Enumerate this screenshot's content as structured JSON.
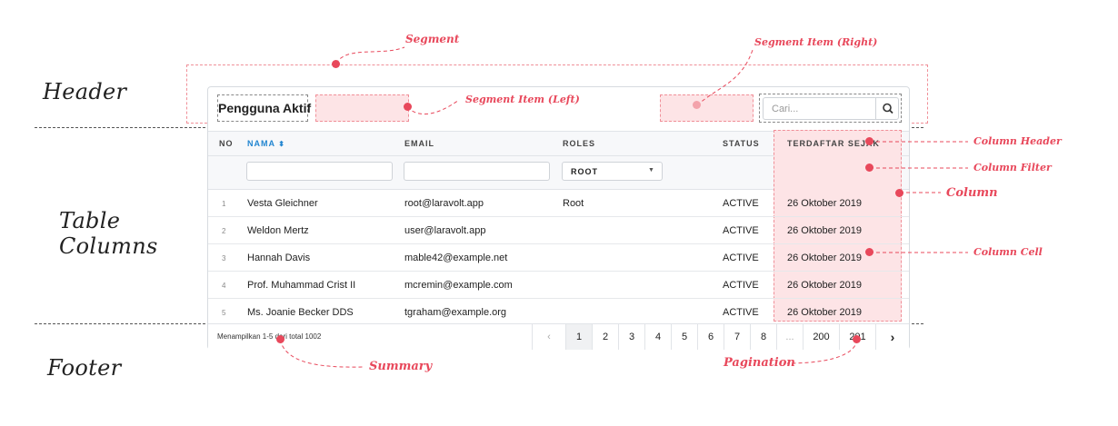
{
  "section_labels": {
    "header": "Header",
    "table_columns_line1": "Table",
    "table_columns_line2": "Columns",
    "footer": "Footer"
  },
  "annotations": {
    "segment": "Segment",
    "segment_item_right": "Segment Item (Right)",
    "segment_item_left": "Segment Item (Left)",
    "column_header": "Column Header",
    "column_filter": "Column Filter",
    "column": "Column",
    "column_cell": "Column Cell",
    "summary": "Summary",
    "pagination": "Pagination"
  },
  "header": {
    "title": "Pengguna Aktif",
    "search_placeholder": "Cari...",
    "search_icon": "search-icon"
  },
  "columns": {
    "no": "NO",
    "nama": "NAMA",
    "email": "EMAIL",
    "roles": "ROLES",
    "status": "STATUS",
    "terdaftar": "TERDAFTAR SEJAK"
  },
  "filters": {
    "roles_selected": "ROOT"
  },
  "rows": [
    {
      "no": "1",
      "name": "Vesta Gleichner",
      "email": "root@laravolt.app",
      "role": "Root",
      "status": "ACTIVE",
      "date": "26 Oktober 2019"
    },
    {
      "no": "2",
      "name": "Weldon Mertz",
      "email": "user@laravolt.app",
      "role": "",
      "status": "ACTIVE",
      "date": "26 Oktober 2019"
    },
    {
      "no": "3",
      "name": "Hannah Davis",
      "email": "mable42@example.net",
      "role": "",
      "status": "ACTIVE",
      "date": "26 Oktober 2019"
    },
    {
      "no": "4",
      "name": "Prof. Muhammad Crist II",
      "email": "mcremin@example.com",
      "role": "",
      "status": "ACTIVE",
      "date": "26 Oktober 2019"
    },
    {
      "no": "5",
      "name": "Ms. Joanie Becker DDS",
      "email": "tgraham@example.org",
      "role": "",
      "status": "ACTIVE",
      "date": "26 Oktober 2019"
    }
  ],
  "footer": {
    "summary": "Menampilkan 1-5 dari total 1002",
    "pages": [
      "1",
      "2",
      "3",
      "4",
      "5",
      "6",
      "7",
      "8",
      "...",
      "200",
      "201"
    ],
    "prev": "‹",
    "next": "›"
  },
  "colors": {
    "accent": "#e8485b",
    "highlight": "#fde4e6",
    "sort_link": "#2185d0"
  }
}
